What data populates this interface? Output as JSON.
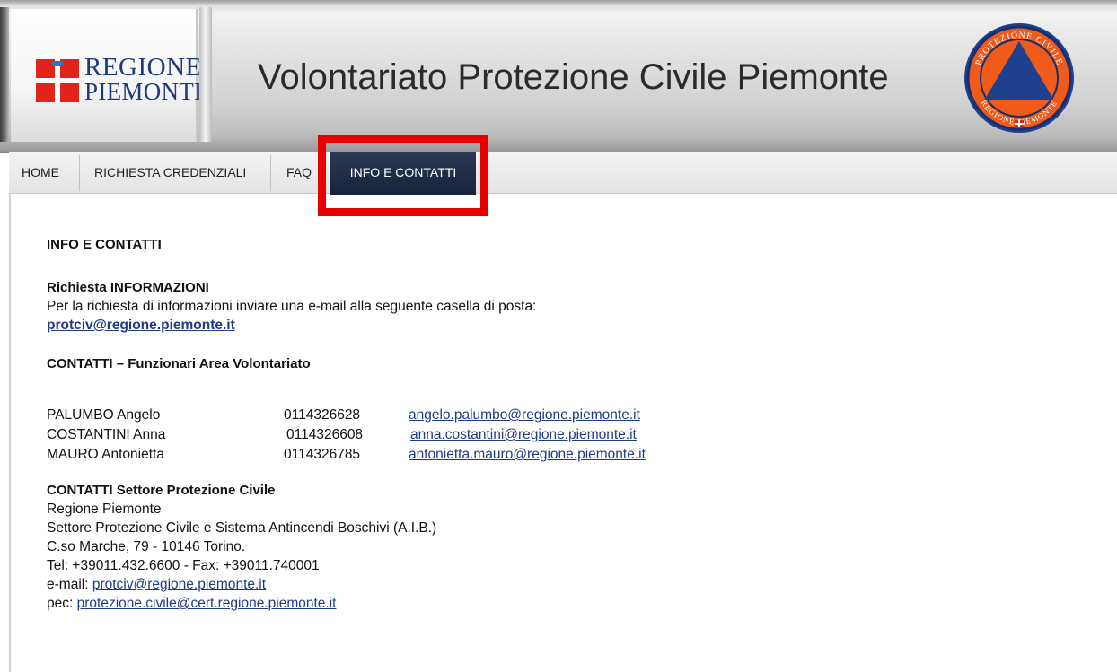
{
  "header": {
    "logo_line1": "REGIONE",
    "logo_line2": "PIEMONTE",
    "title": "Volontariato Protezione Civile Piemonte",
    "emblem_text_top": "PROTEZIONE CIVILE",
    "emblem_text_bottom": "REGIONE PIEMONTE"
  },
  "nav": {
    "items": [
      {
        "label": "HOME"
      },
      {
        "label": "RICHIESTA CREDENZIALI"
      },
      {
        "label": "FAQ"
      },
      {
        "label": "INFO E CONTATTI",
        "active": true
      }
    ]
  },
  "content": {
    "heading": "INFO E CONTATTI",
    "info": {
      "title": "Richiesta INFORMAZIONI",
      "text": "Per la richiesta di informazioni inviare una e-mail alla seguente casella di posta:",
      "email": "protciv@regione.piemonte.it"
    },
    "funzionari": {
      "title": "CONTATTI – Funzionari Area Volontariato",
      "rows": [
        {
          "name": "PALUMBO Angelo",
          "tel": "0114326628",
          "email": "angelo.palumbo@regione.piemonte.it"
        },
        {
          "name": "COSTANTINI Anna",
          "tel": "0114326608",
          "email": "anna.costantini@regione.piemonte.it"
        },
        {
          "name": "MAURO Antonietta",
          "tel": "0114326785",
          "email": "antonietta.mauro@regione.piemonte.it"
        }
      ]
    },
    "settore": {
      "title": "CONTATTI Settore Protezione Civile",
      "line1": "Regione Piemonte",
      "line2": "Settore Protezione Civile e Sistema Antincendi Boschivi (A.I.B.)",
      "line3": "C.so Marche, 79 - 10146 Torino.",
      "line4": "Tel: +39011.432.6600 - Fax: +39011.740001",
      "email_label": "e-mail: ",
      "email": "protciv@regione.piemonte.it",
      "pec_label": "pec: ",
      "pec": "protezione.civile@cert.regione.piemonte.it"
    }
  },
  "colors": {
    "nav_active_bg": "#1d2a44",
    "highlight": "#e60000",
    "link": "#1f3b87",
    "logo_red": "#e2231a",
    "logo_blue": "#1e3b7d",
    "emblem_orange": "#f05a1a",
    "emblem_blue": "#1f3f8f"
  }
}
